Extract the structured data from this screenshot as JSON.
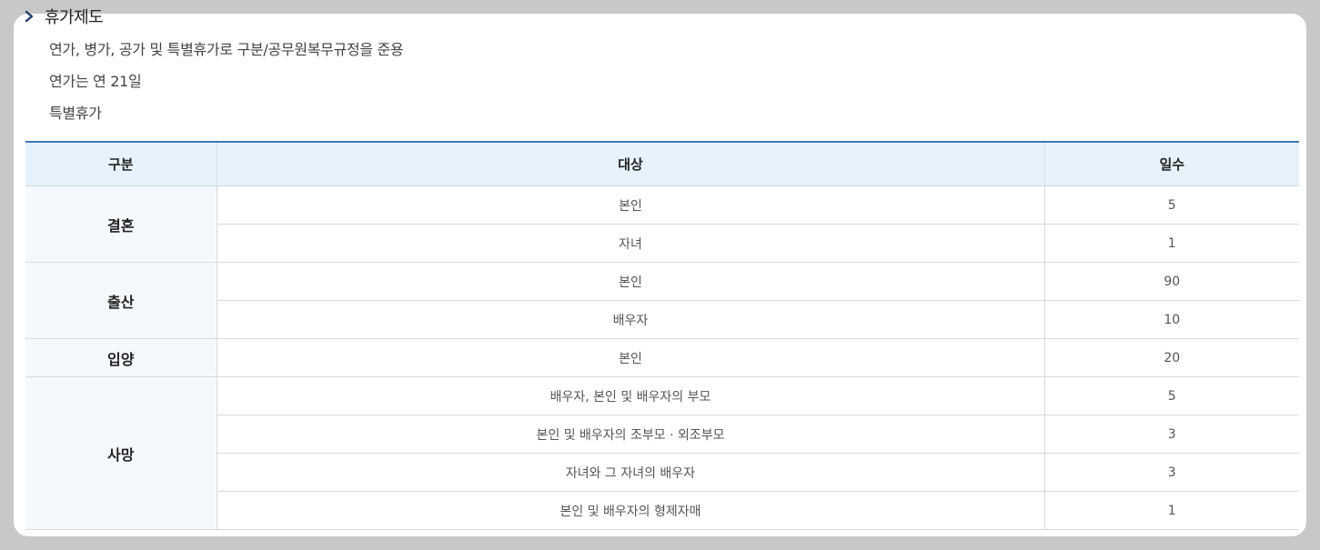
{
  "section": {
    "title": "휴가제도",
    "icon": "chevron-right-icon",
    "accent": "#1f3e6e"
  },
  "lines": [
    "연가, 병가, 공가 및 특별휴가로 구분/공무원복무규정을 준용",
    "연가는 연 21일",
    "특별휴가"
  ],
  "table": {
    "headers": [
      "구분",
      "대상",
      "일수"
    ],
    "groups": [
      {
        "category": "결혼",
        "rows": [
          {
            "target": "본인",
            "days": "5"
          },
          {
            "target": "자녀",
            "days": "1"
          }
        ]
      },
      {
        "category": "출산",
        "rows": [
          {
            "target": "본인",
            "days": "90"
          },
          {
            "target": "배우자",
            "days": "10"
          }
        ]
      },
      {
        "category": "입양",
        "rows": [
          {
            "target": "본인",
            "days": "20"
          }
        ]
      },
      {
        "category": "사망",
        "rows": [
          {
            "target": "배우자, 본인 및 배우자의 부모",
            "days": "5"
          },
          {
            "target": "본인 및 배우자의 조부모 · 외조부모",
            "days": "3"
          },
          {
            "target": "자녀와 그 자녀의 배우자",
            "days": "3"
          },
          {
            "target": "본인 및 배우자의 형제자매",
            "days": "1"
          }
        ]
      }
    ],
    "colors": {
      "header_bg": "#e6f3fd",
      "header_border": "#3e78b8",
      "category_bg": "#f5f9fe"
    }
  }
}
